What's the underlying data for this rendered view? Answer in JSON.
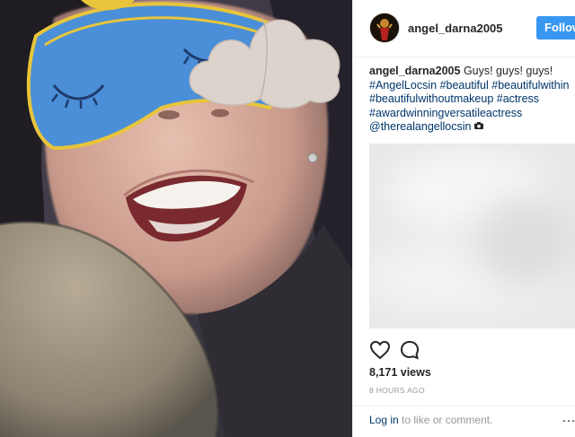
{
  "post": {
    "username": "angel_darna2005",
    "follow_label": "Follow",
    "caption": {
      "username": "angel_darna2005",
      "text": "Guys! guys! guys!",
      "tags": [
        "#AngelLocsin",
        "#beautiful",
        "#beautifulwithin",
        "#beautifulwithoutmakeup",
        "#actress",
        "#awardwinningversatileactress",
        "@therealangellocsin"
      ]
    },
    "views": "8,171 views",
    "time": "8 HOURS AGO",
    "login_link": "Log in",
    "login_rest": "to like or comment.",
    "more_glyph": "…"
  },
  "colors": {
    "follow_button": "#3897f0",
    "link": "#003569",
    "mask_blue": "#4a8fd8",
    "mask_trim": "#e8c53a"
  },
  "icons": [
    "heart-icon",
    "comment-icon",
    "camera-icon",
    "more-icon"
  ]
}
